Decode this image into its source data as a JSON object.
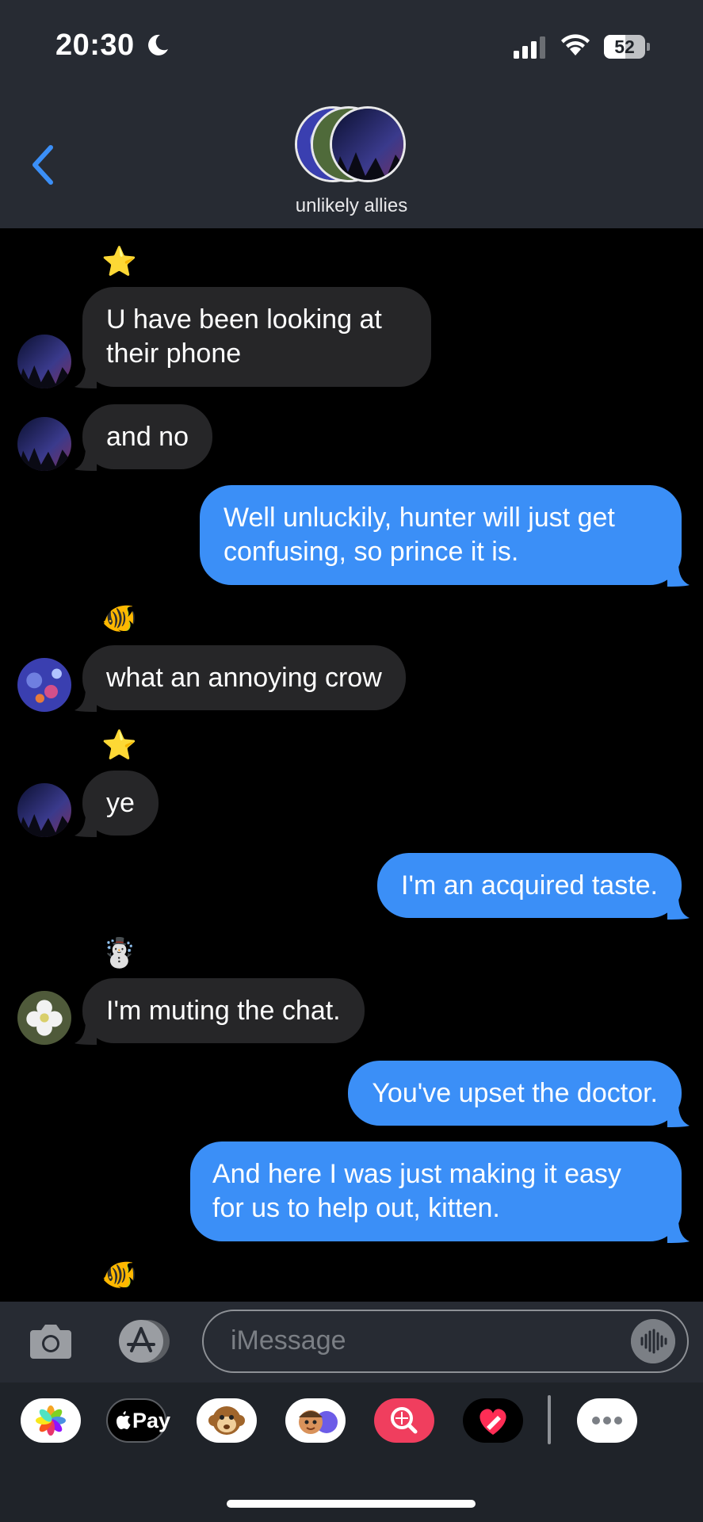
{
  "status_bar": {
    "time": "20:30",
    "battery_level": "52",
    "battery_fraction": 0.52
  },
  "header": {
    "group_name": "unlikely allies"
  },
  "messages": [
    {
      "text": "U have been looking at their phone"
    },
    {
      "text": "and no"
    },
    {
      "text": "Well unluckily, hunter will just get confusing, so prince it is."
    },
    {
      "text": "what an annoying crow"
    },
    {
      "text": "ye"
    },
    {
      "text": "I'm an acquired taste."
    },
    {
      "text": "I'm muting the chat."
    },
    {
      "text": "You've upset the doctor."
    },
    {
      "text": "And here I was just making it easy for us to help out, kitten."
    }
  ],
  "sender_markers": [
    "⭐",
    "🐠",
    "⭐",
    "☃️",
    "🐠"
  ],
  "compose": {
    "placeholder": "iMessage"
  },
  "app_tray": {
    "apple_pay_label": "Pay"
  },
  "colors": {
    "sent_bubble": "#3b8ff7",
    "received_bubble": "#262628",
    "back_chevron": "#3b8ff7"
  }
}
